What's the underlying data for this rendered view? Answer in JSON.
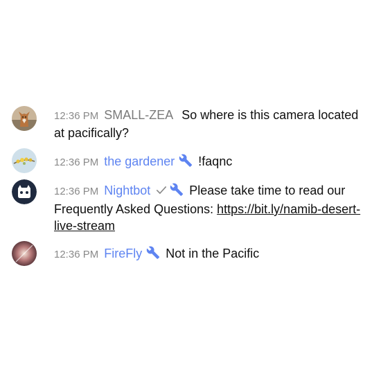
{
  "messages": [
    {
      "avatar": "fox-avatar",
      "time": "12:36 PM",
      "author": "SMALL-ZEA",
      "author_role": "member",
      "text": "So where is this camera located at pacifically?"
    },
    {
      "avatar": "flower-avatar",
      "time": "12:36 PM",
      "author": "the gardener",
      "author_role": "moderator",
      "text": "!faqnc"
    },
    {
      "avatar": "nightbot-avatar",
      "time": "12:36 PM",
      "author": "Nightbot",
      "author_role": "moderator",
      "verified": true,
      "text": "Please take time to read our Frequently Asked Questions:",
      "link": "https://bit.ly/namib-desert-live-stream"
    },
    {
      "avatar": "firefly-avatar",
      "time": "12:36 PM",
      "author": "FireFly",
      "author_role": "moderator",
      "text": "Not in the Pacific"
    }
  ],
  "colors": {
    "moderator_name": "#5e84f1",
    "member_name": "#7a7a7a",
    "timestamp": "#8a8a8a",
    "message_text": "#0f0f0f"
  },
  "icons": {
    "moderator_badge": "wrench-icon",
    "verified_badge": "checkmark-icon"
  }
}
